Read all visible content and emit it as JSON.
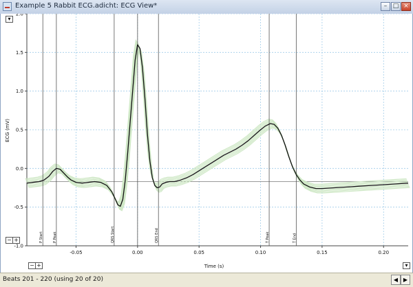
{
  "window": {
    "title": "Example 5 Rabbit ECG.adicht: ECG View*",
    "minimize_glyph": "–",
    "maximize_glyph": "□",
    "close_glyph": "×"
  },
  "controls": {
    "top_dropdown_glyph": "▾",
    "y_zoom_out_glyph": "−",
    "y_zoom_in_glyph": "+",
    "x_zoom_out_glyph": "−",
    "x_zoom_in_glyph": "+",
    "corner_dropdown_glyph": "▾"
  },
  "statusbar": {
    "text": "Beats 201 - 220 (using 20 of 20)",
    "prev_glyph": "◀",
    "next_glyph": "▶"
  },
  "chart_data": {
    "type": "line",
    "xlabel": "Time (s)",
    "ylabel": "ECG (mV)",
    "xlim": [
      -0.09,
      0.22
    ],
    "ylim": [
      -1.0,
      2.0
    ],
    "x_ticks": [
      -0.05,
      0.0,
      0.05,
      0.1,
      0.15,
      0.2
    ],
    "x_tick_labels": [
      "-0.05",
      "0.00",
      "0.05",
      "0.10",
      "0.15",
      "0.20"
    ],
    "y_ticks": [
      -1.0,
      -0.5,
      0.0,
      0.5,
      1.0,
      1.5,
      2.0
    ],
    "y_tick_labels": [
      "-1.0",
      "-0.5",
      "0.0",
      "0.5",
      "1.0",
      "1.5",
      "2.0"
    ],
    "grid": true,
    "baseline": -0.17,
    "series": [
      {
        "color": "#111111",
        "x": [
          -0.09,
          -0.085,
          -0.08,
          -0.076,
          -0.072,
          -0.069,
          -0.066,
          -0.063,
          -0.06,
          -0.057,
          -0.054,
          -0.05,
          -0.045,
          -0.04,
          -0.035,
          -0.03,
          -0.025,
          -0.021,
          -0.018,
          -0.016,
          -0.014,
          -0.012,
          -0.01,
          -0.008,
          -0.006,
          -0.004,
          -0.002,
          0.0,
          0.002,
          0.004,
          0.006,
          0.008,
          0.01,
          0.012,
          0.014,
          0.016,
          0.018,
          0.02,
          0.023,
          0.026,
          0.03,
          0.035,
          0.04,
          0.045,
          0.05,
          0.055,
          0.06,
          0.065,
          0.07,
          0.075,
          0.08,
          0.085,
          0.09,
          0.095,
          0.1,
          0.104,
          0.108,
          0.111,
          0.114,
          0.117,
          0.12,
          0.123,
          0.126,
          0.129,
          0.132,
          0.135,
          0.14,
          0.145,
          0.15,
          0.16,
          0.17,
          0.18,
          0.19,
          0.2,
          0.21,
          0.22
        ],
        "values": [
          -0.19,
          -0.18,
          -0.17,
          -0.15,
          -0.1,
          -0.04,
          0.0,
          -0.01,
          -0.06,
          -0.11,
          -0.15,
          -0.18,
          -0.19,
          -0.18,
          -0.17,
          -0.18,
          -0.22,
          -0.3,
          -0.4,
          -0.47,
          -0.49,
          -0.4,
          -0.15,
          0.2,
          0.6,
          1.0,
          1.4,
          1.6,
          1.55,
          1.3,
          0.9,
          0.45,
          0.1,
          -0.12,
          -0.22,
          -0.25,
          -0.24,
          -0.2,
          -0.18,
          -0.17,
          -0.17,
          -0.15,
          -0.12,
          -0.08,
          -0.03,
          0.02,
          0.07,
          0.12,
          0.17,
          0.21,
          0.25,
          0.3,
          0.36,
          0.43,
          0.5,
          0.55,
          0.58,
          0.57,
          0.52,
          0.43,
          0.3,
          0.15,
          0.02,
          -0.08,
          -0.15,
          -0.2,
          -0.24,
          -0.26,
          -0.26,
          -0.25,
          -0.24,
          -0.23,
          -0.22,
          -0.21,
          -0.2,
          -0.19
        ]
      }
    ],
    "markers": [
      {
        "x": -0.077,
        "label": "P Start"
      },
      {
        "x": -0.066,
        "label": "P Peak"
      },
      {
        "x": -0.019,
        "label": "QRS Start"
      },
      {
        "x": 0.0,
        "label": ""
      },
      {
        "x": 0.017,
        "label": "QRS End"
      },
      {
        "x": 0.107,
        "label": "T Peak"
      },
      {
        "x": 0.129,
        "label": "T End"
      }
    ]
  }
}
